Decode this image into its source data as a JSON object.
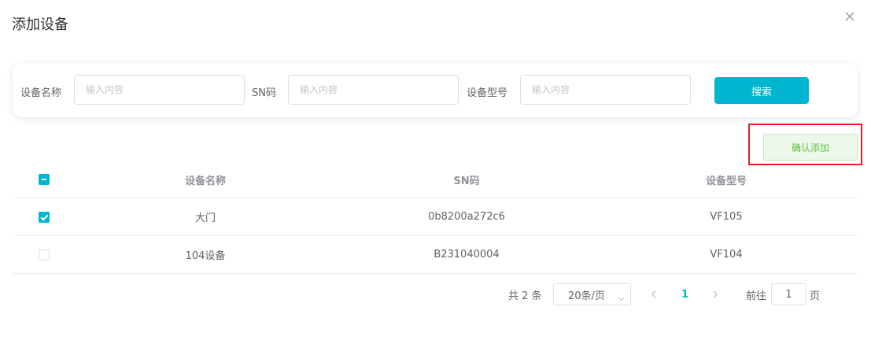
{
  "dialog": {
    "title": "添加设备"
  },
  "search": {
    "name_label": "设备名称",
    "name_placeholder": "输入内容",
    "sn_label": "SN码",
    "sn_placeholder": "输入内容",
    "model_label": "设备型号",
    "model_placeholder": "输入内容",
    "search_button": "搜索"
  },
  "actions": {
    "confirm_add": "确认添加"
  },
  "table": {
    "columns": [
      "设备名称",
      "SN码",
      "设备型号"
    ],
    "rows": [
      {
        "checked": true,
        "name": "大门",
        "sn": "0b8200a272c6",
        "model": "VF105"
      },
      {
        "checked": false,
        "name": "104设备",
        "sn": "B231040004",
        "model": "VF104"
      }
    ]
  },
  "pagination": {
    "total_text": "共 2 条",
    "page_size": "20条/页",
    "current_page": "1",
    "goto_prefix": "前往",
    "goto_value": "1",
    "goto_suffix": "页"
  },
  "colors": {
    "accent": "#00b5cf",
    "confirm_text": "#67c23a",
    "highlight_border": "#e02020"
  }
}
